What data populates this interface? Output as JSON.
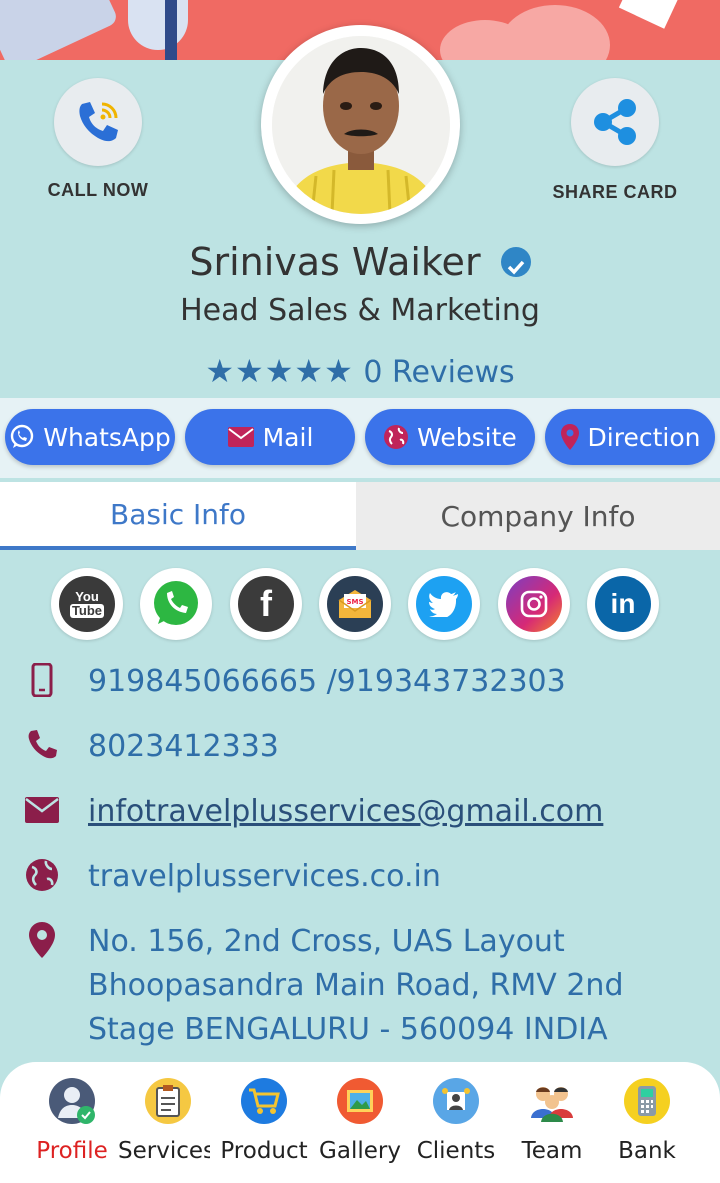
{
  "header": {
    "call_label": "CALL NOW",
    "share_label": "SHARE CARD"
  },
  "profile": {
    "name": "Srinivas Waiker",
    "title": "Head Sales & Marketing",
    "rating_stars": "★★★★★",
    "reviews": "0 Reviews"
  },
  "actions": [
    {
      "label": "WhatsApp",
      "icon": "whatsapp-icon"
    },
    {
      "label": "Mail",
      "icon": "mail-icon"
    },
    {
      "label": "Website",
      "icon": "globe-icon"
    },
    {
      "label": "Direction",
      "icon": "map-pin-icon"
    }
  ],
  "tabs": {
    "basic": "Basic Info",
    "company": "Company Info"
  },
  "social": [
    {
      "name": "youtube-icon",
      "text": "You Tube"
    },
    {
      "name": "whatsapp-icon"
    },
    {
      "name": "facebook-icon",
      "text": "f"
    },
    {
      "name": "sms-icon",
      "text": "SMS"
    },
    {
      "name": "twitter-icon"
    },
    {
      "name": "instagram-icon"
    },
    {
      "name": "linkedin-icon",
      "text": "in"
    }
  ],
  "contact": {
    "mobile": "919845066665 /919343732303",
    "phone": "8023412333",
    "email": "infotravelplusservices@gmail.com",
    "website": "travelplusservices.co.in",
    "address": "No. 156, 2nd Cross, UAS Layout Bhoopasandra Main Road, RMV 2nd Stage BENGALURU - 560094 INDIA"
  },
  "nav": [
    {
      "label": "Profile",
      "icon": "profile-icon"
    },
    {
      "label": "Services",
      "icon": "services-icon"
    },
    {
      "label": "Product",
      "icon": "product-icon"
    },
    {
      "label": "Gallery",
      "icon": "gallery-icon"
    },
    {
      "label": "Clients",
      "icon": "clients-icon"
    },
    {
      "label": "Team",
      "icon": "team-icon"
    },
    {
      "label": "Bank",
      "icon": "bank-icon"
    }
  ],
  "colors": {
    "background": "#bde3e3",
    "accent": "#3b73ea",
    "link": "#2f6ea8",
    "icon_maroon": "#8b1e4a",
    "banner": "#f06a63"
  }
}
